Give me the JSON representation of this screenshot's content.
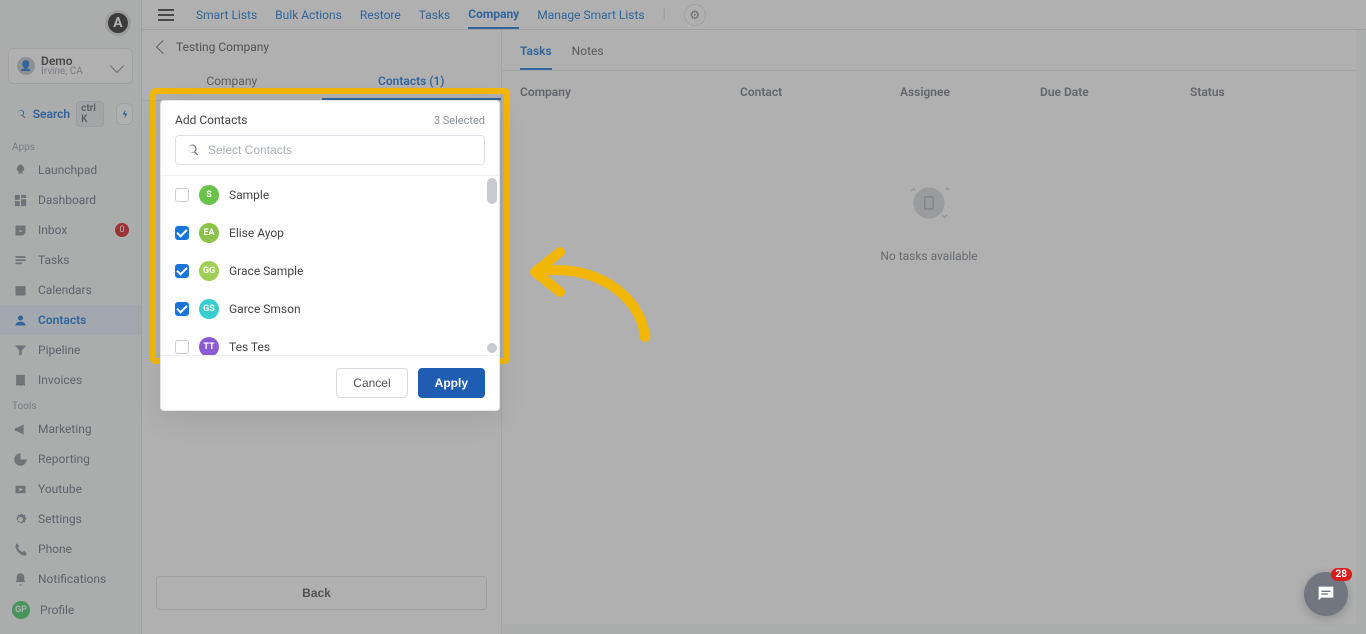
{
  "brand_letter": "A",
  "account": {
    "name": "Demo",
    "location": "Irvine, CA"
  },
  "search": {
    "label": "Search",
    "shortcut": "ctrl K"
  },
  "sections": {
    "apps": "Apps",
    "tools": "Tools"
  },
  "nav": {
    "launchpad": "Launchpad",
    "dashboard": "Dashboard",
    "inbox": "Inbox",
    "inbox_badge": "0",
    "tasks": "Tasks",
    "calendars": "Calendars",
    "contacts": "Contacts",
    "pipeline": "Pipeline",
    "invoices": "Invoices",
    "marketing": "Marketing",
    "reporting": "Reporting",
    "youtube": "Youtube",
    "settings": "Settings"
  },
  "footer": {
    "phone": "Phone",
    "notifications": "Notifications",
    "profile": "Profile",
    "profile_initials": "GP"
  },
  "topnav": {
    "smart_lists": "Smart Lists",
    "bulk_actions": "Bulk Actions",
    "restore": "Restore",
    "tasks": "Tasks",
    "company": "Company",
    "manage_smart_lists": "Manage Smart Lists"
  },
  "breadcrumb": "Testing Company",
  "left_tabs": {
    "company": "Company",
    "contacts": "Contacts (1)"
  },
  "back_label": "Back",
  "right_tabs": {
    "tasks": "Tasks",
    "notes": "Notes"
  },
  "task_columns": {
    "company": "Company",
    "contact": "Contact",
    "assignee": "Assignee",
    "due_date": "Due Date",
    "status": "Status"
  },
  "empty_message": "No tasks available",
  "modal": {
    "title": "Add Contacts",
    "selected_text": "3 Selected",
    "search_placeholder": "Select Contacts",
    "cancel": "Cancel",
    "apply": "Apply",
    "contacts": [
      {
        "name": "Sample",
        "initials": "S",
        "color": "#6bc24a",
        "checked": false
      },
      {
        "name": "Elise Ayop",
        "initials": "EA",
        "color": "#8bc34a",
        "checked": true
      },
      {
        "name": "Grace Sample",
        "initials": "GG",
        "color": "#9fcf57",
        "checked": true
      },
      {
        "name": "Garce Smson",
        "initials": "GS",
        "color": "#39cfcf",
        "checked": true
      },
      {
        "name": "Tes Tes",
        "initials": "TT",
        "color": "#8a5cd4",
        "checked": false
      }
    ]
  },
  "chat_badge": "28"
}
